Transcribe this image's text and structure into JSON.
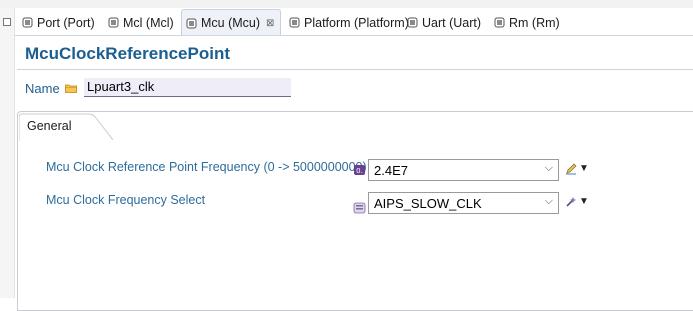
{
  "tabs": [
    {
      "label": "Port (Port)",
      "active": false
    },
    {
      "label": "Mcl (Mcl)",
      "active": false
    },
    {
      "label": "Mcu (Mcu)",
      "active": true,
      "close": "⊠"
    },
    {
      "label": "Platform (Platform)",
      "active": false
    },
    {
      "label": "Uart (Uart)",
      "active": false
    },
    {
      "label": "Rm (Rm)",
      "active": false
    }
  ],
  "editor": {
    "title": "McuClockReferencePoint",
    "name_label": "Name",
    "name_value": "Lpuart3_clk",
    "section_tab": "General"
  },
  "fields": [
    {
      "label": "Mcu Clock Reference Point Frequency (0 -> 5000000000)",
      "value": "2.4E7",
      "type_icon": "float-type-icon",
      "action_icon": "edit-pencil-icon"
    },
    {
      "label": "Mcu Clock Frequency Select",
      "value": "AIPS_SLOW_CLK",
      "type_icon": "enum-type-icon",
      "action_icon": "wand-icon"
    }
  ],
  "colors": {
    "title": "#1b5e91",
    "label": "#2d6d9c",
    "name_field_bg": "#efedf7"
  }
}
